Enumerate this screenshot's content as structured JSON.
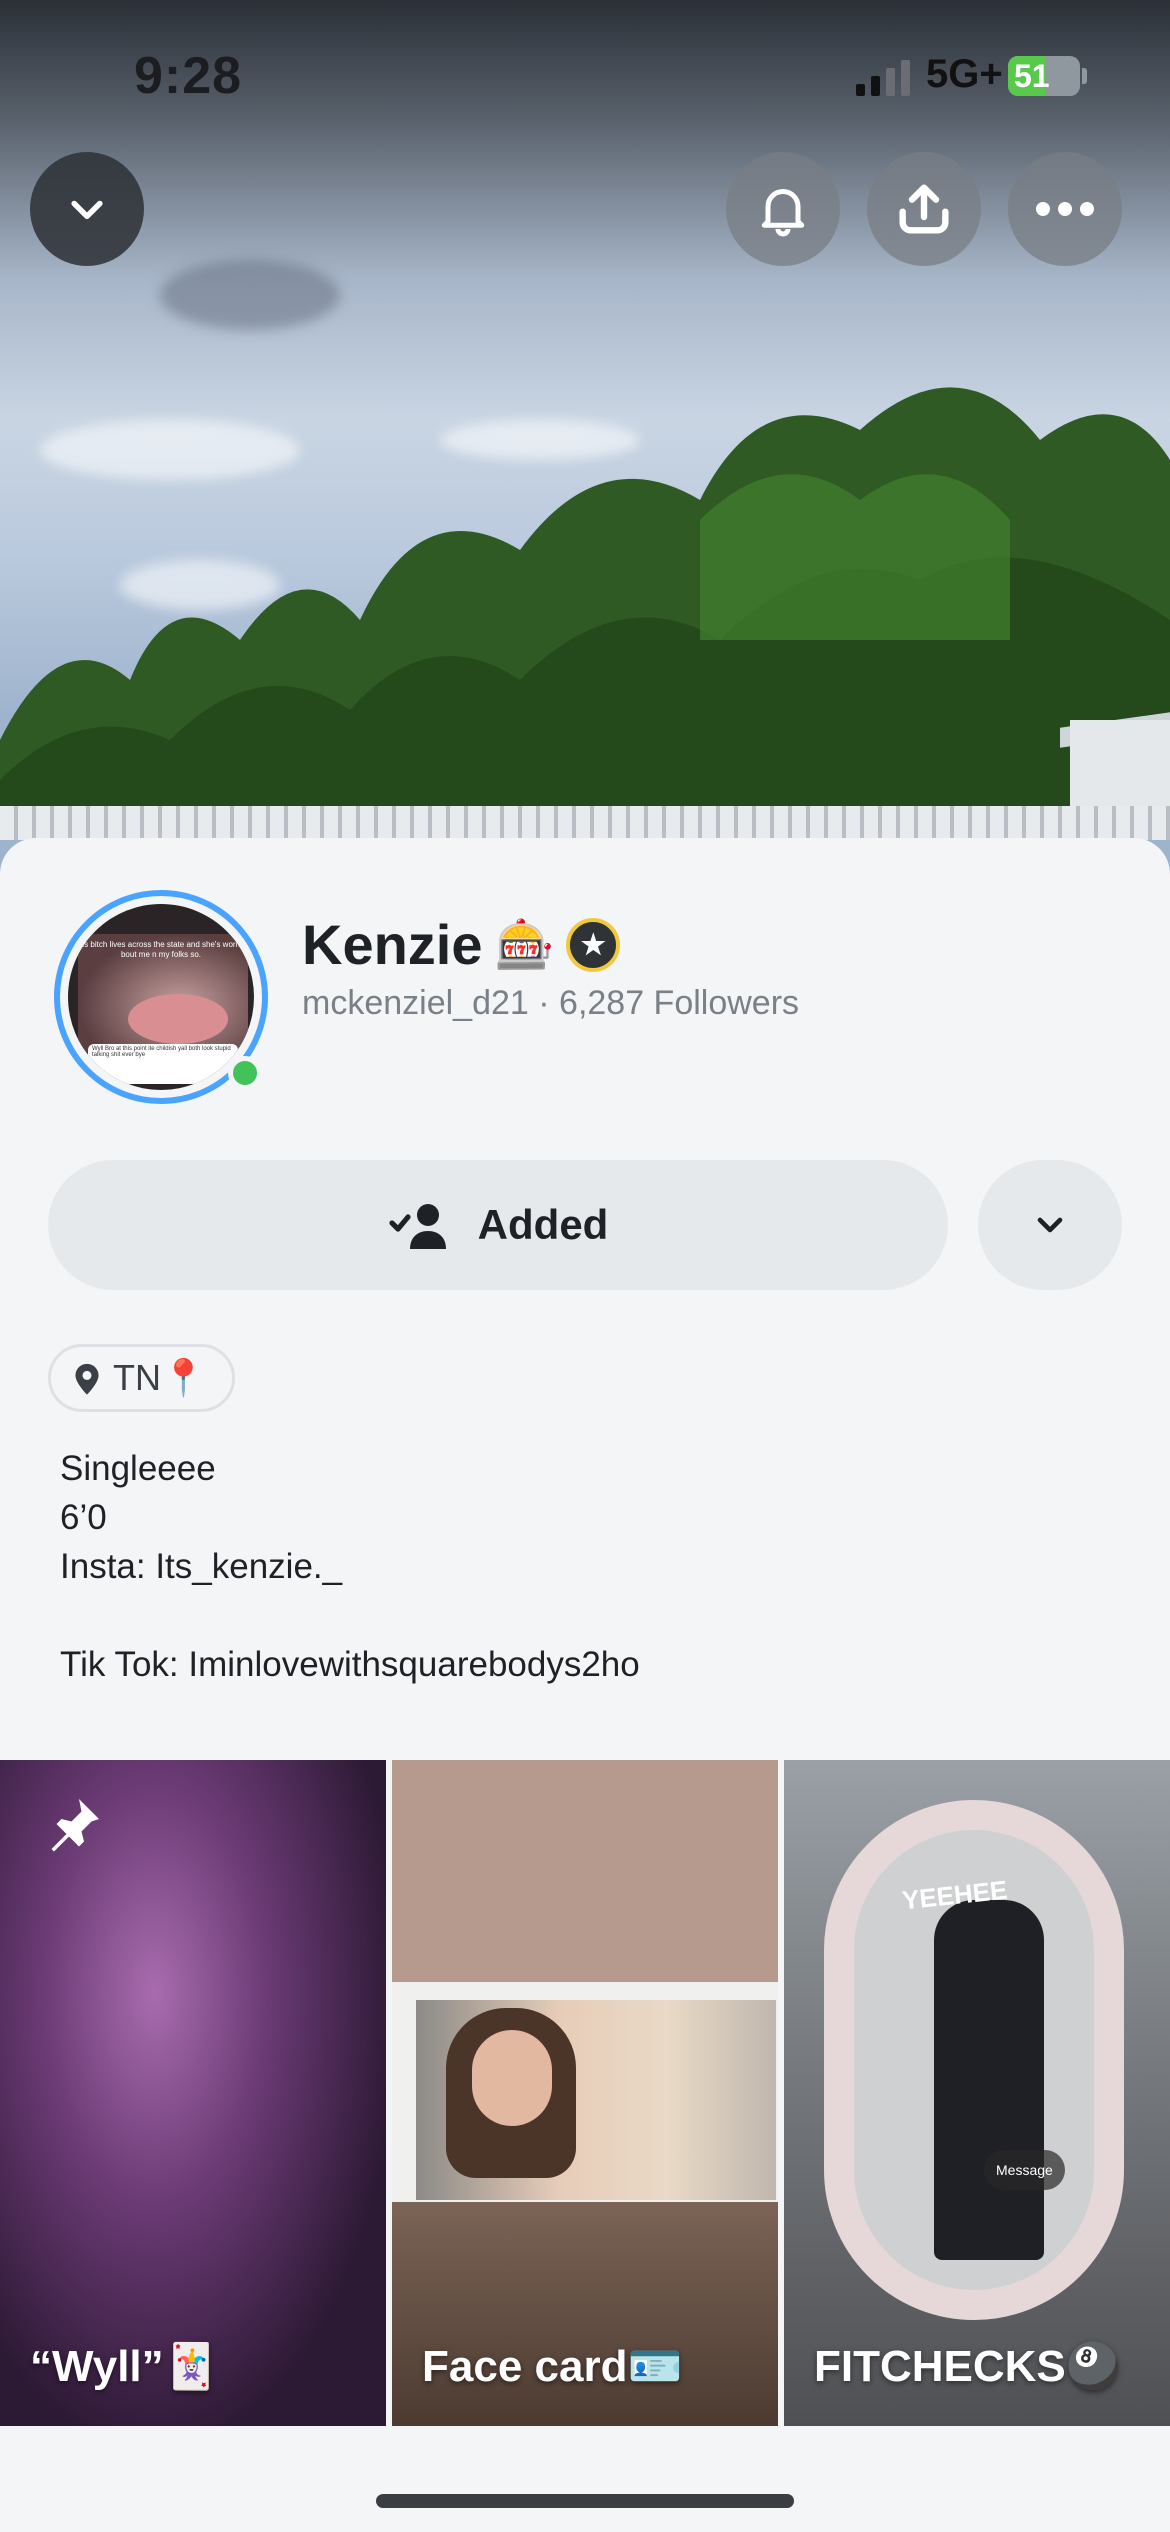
{
  "status_bar": {
    "time": "9:28",
    "network": "5G+",
    "battery_percent": "51",
    "battery_level": 0.51,
    "signal_bars_active": 2
  },
  "header_actions": {
    "back_icon": "chevron-down-icon",
    "notifications_icon": "bell-icon",
    "share_icon": "share-upload-icon",
    "more_icon": "more-horizontal-icon"
  },
  "profile": {
    "display_name": "Kenzie",
    "name_emoji": "🎰",
    "username": "mckenziel_d21",
    "followers": "6,287 Followers",
    "separator": "·",
    "avatar_caption": "This bitch lives across the state and she's worried bout me n my folks so.",
    "avatar_reply_text": "Wyll \nBro at this point ite childish yall both look stupid talking shit ever bye",
    "online": true,
    "ring_color": "#4aa3ff",
    "online_color": "#41c35a"
  },
  "actions": {
    "added_label": "Added",
    "added_icon": "user-check-icon",
    "more_options_icon": "chevron-down-icon"
  },
  "location": {
    "label": "TN📍",
    "icon": "map-pin-icon"
  },
  "bio": {
    "text": "Singleeee\n 6’0\nInsta: Its_kenzie._\n\nTik Tok: Iminlovewithsquarebodys2ho"
  },
  "stories": [
    {
      "caption": "“Wyll”🃏",
      "pinned": true
    },
    {
      "caption": "Face card🪪",
      "pinned": false
    },
    {
      "caption": "FITCHECKS🎱",
      "pinned": false,
      "overlay_chip": "Message"
    }
  ],
  "overlay_text_tile3": "YEEHEE"
}
